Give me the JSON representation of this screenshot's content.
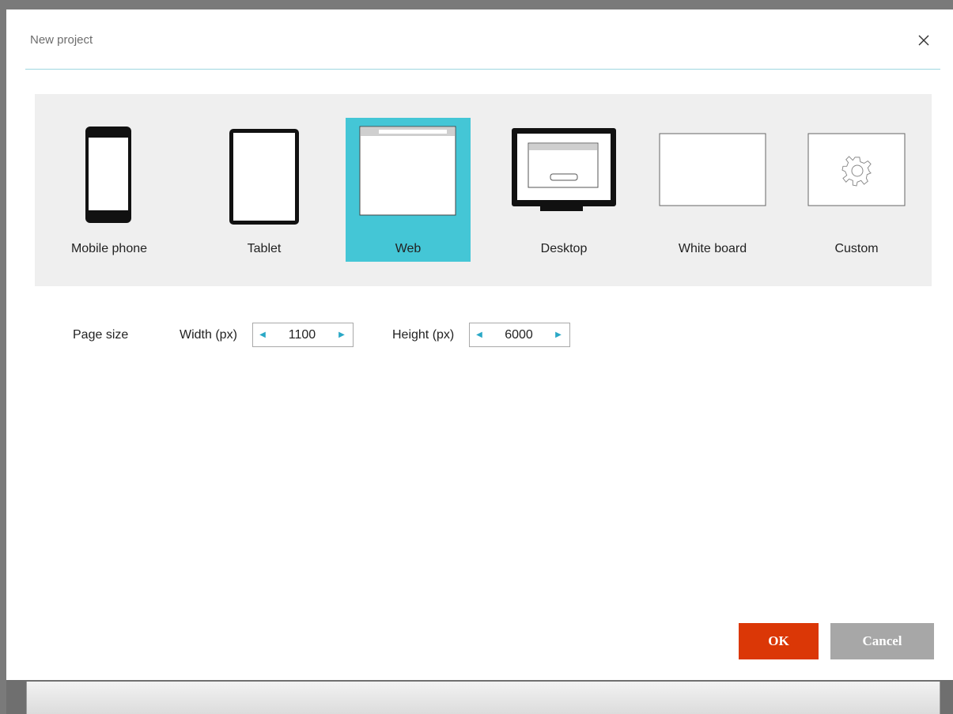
{
  "dialog": {
    "title": "New project",
    "close_icon": "close-icon"
  },
  "project_types": [
    {
      "label": "Mobile phone",
      "icon": "mobile-phone-icon",
      "selected": false
    },
    {
      "label": "Tablet",
      "icon": "tablet-icon",
      "selected": false
    },
    {
      "label": "Web",
      "icon": "web-browser-icon",
      "selected": true
    },
    {
      "label": "Desktop",
      "icon": "desktop-monitor-icon",
      "selected": false
    },
    {
      "label": "White board",
      "icon": "white-board-icon",
      "selected": false
    },
    {
      "label": "Custom",
      "icon": "gear-icon",
      "selected": false
    }
  ],
  "page_size": {
    "label": "Page size",
    "width_label": "Width (px)",
    "width_value": "1100",
    "height_label": "Height (px)",
    "height_value": "6000"
  },
  "buttons": {
    "ok": "OK",
    "cancel": "Cancel"
  },
  "colors": {
    "accent": "#44c6d6",
    "ok_button": "#db3706",
    "cancel_button": "#a7a7a7",
    "title_rule": "#9fd7e0"
  }
}
